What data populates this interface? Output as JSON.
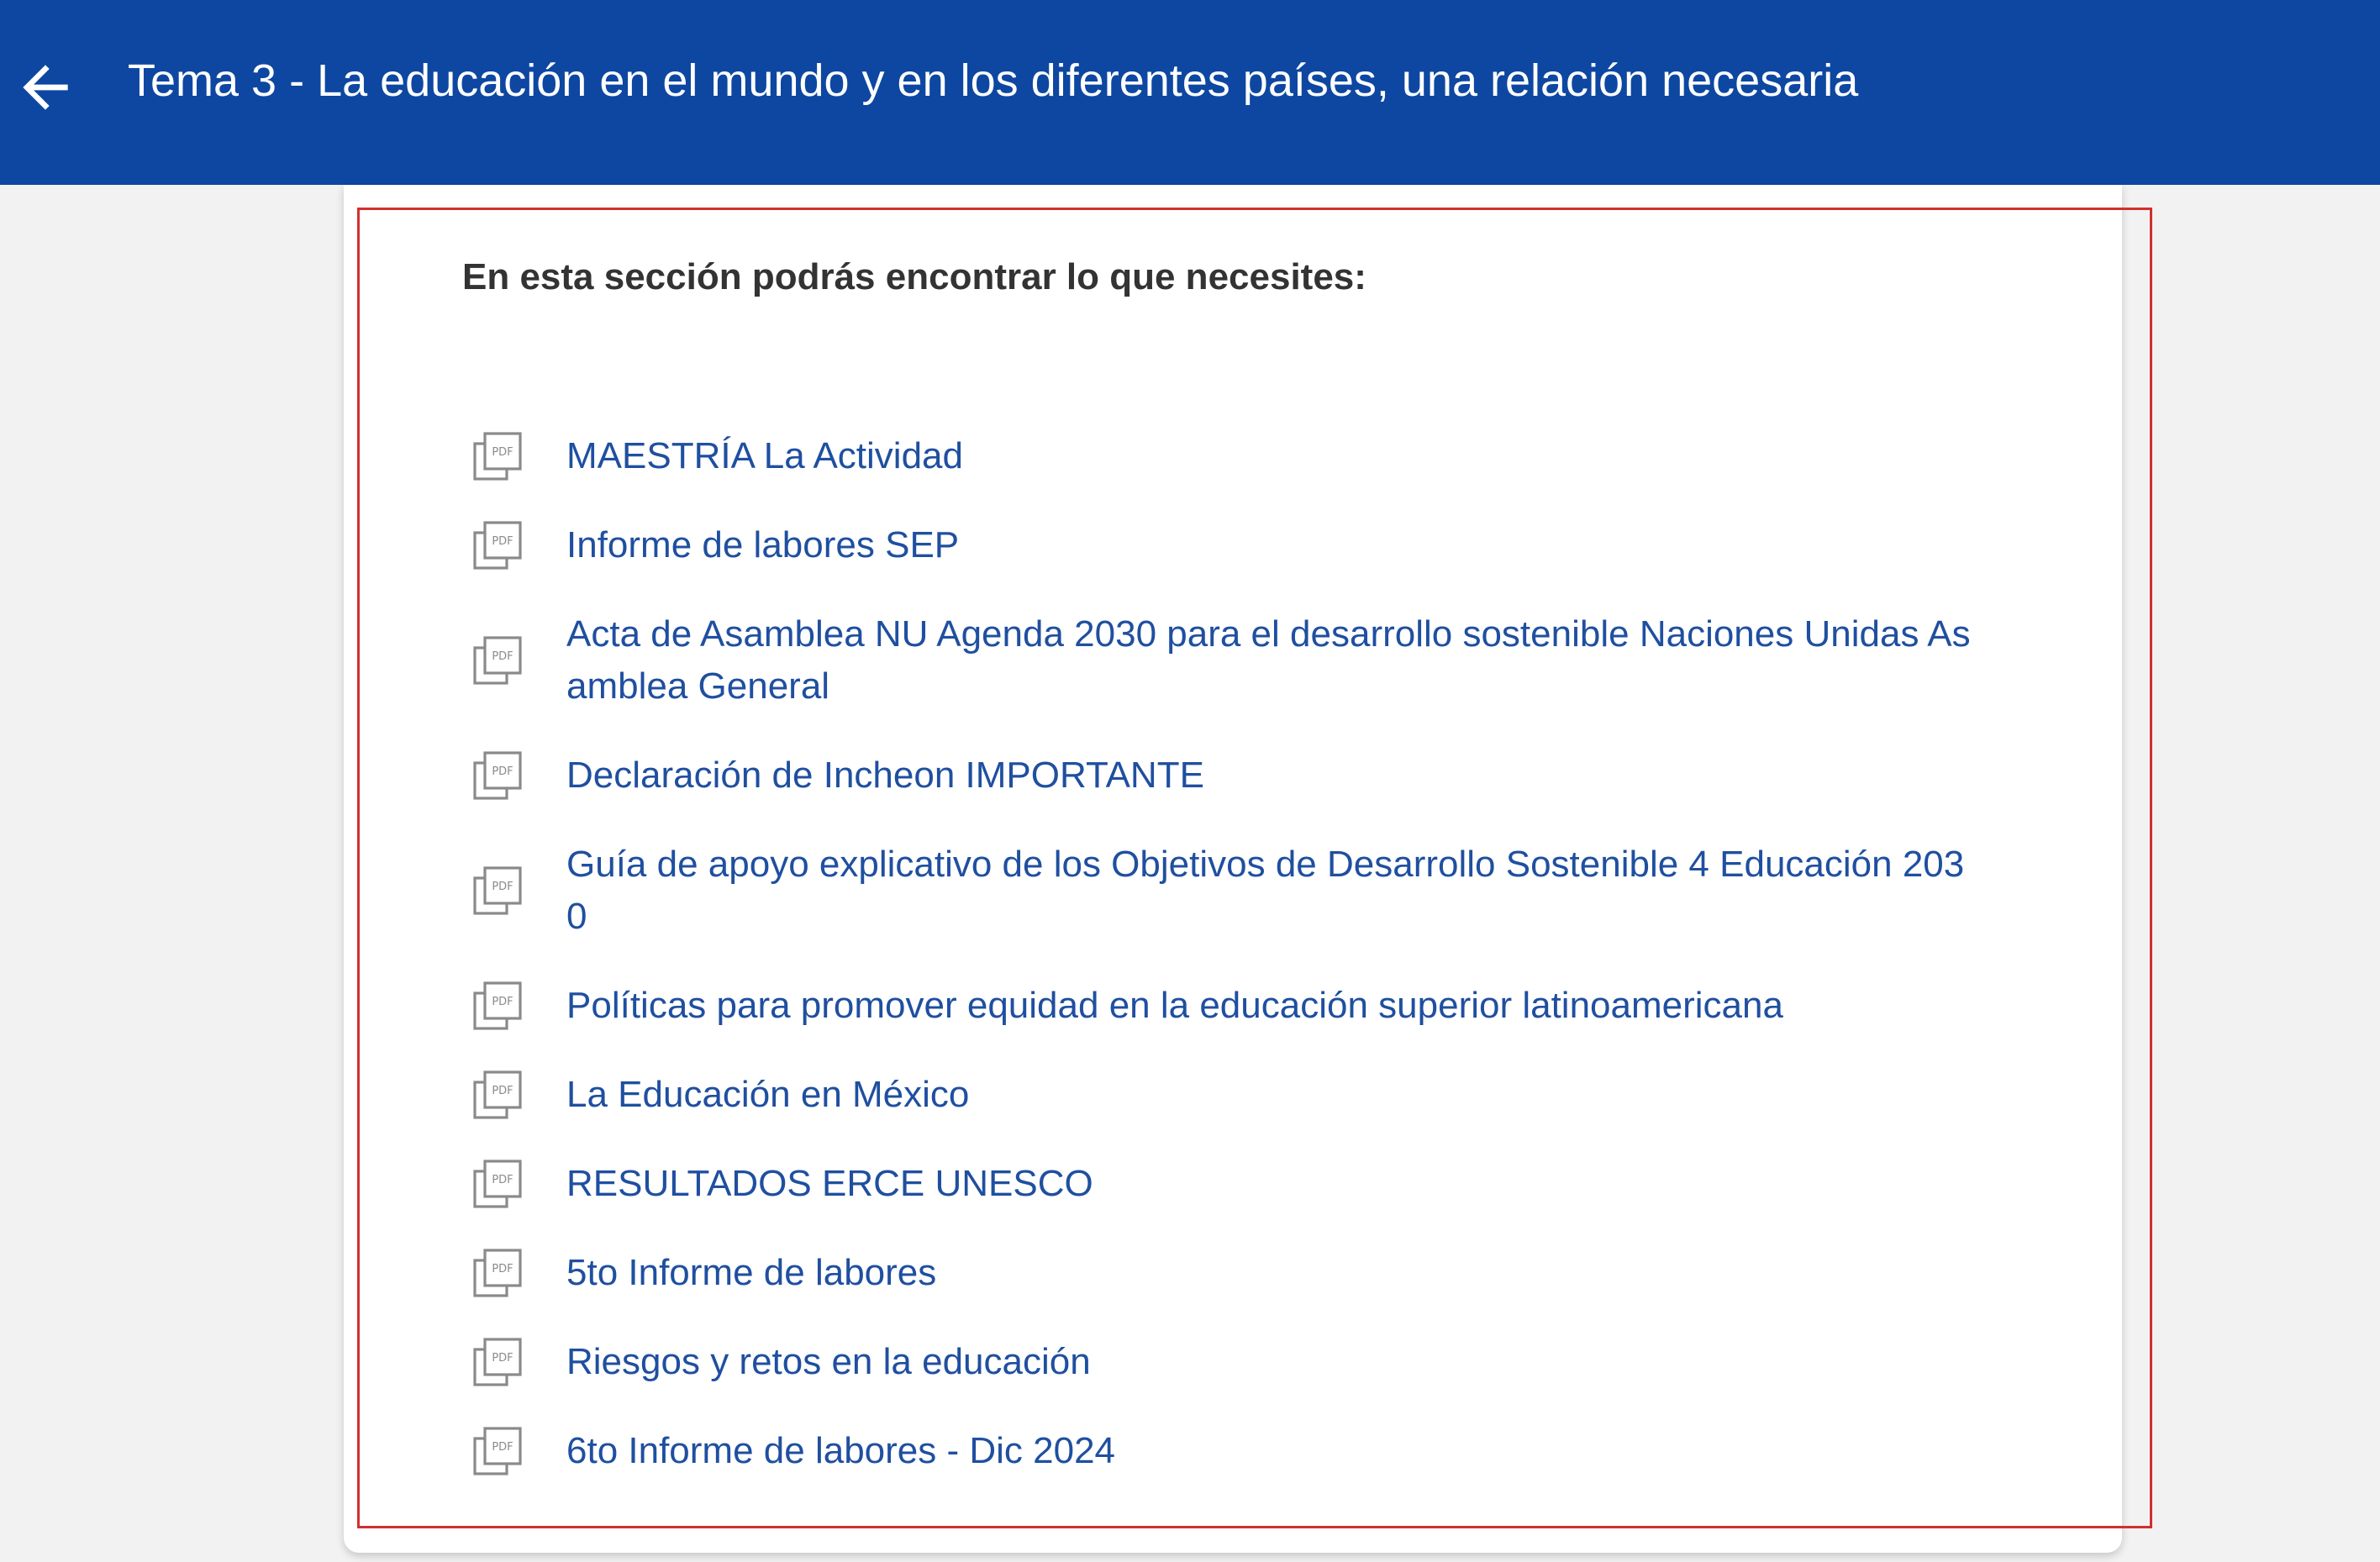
{
  "header": {
    "title": "Tema 3 - La educación en el mundo y en los diferentes países, una relación necesaria",
    "back_icon": "arrow-left-icon",
    "background_color": "#0d47a1"
  },
  "content": {
    "intro": "En esta sección podrás encontrar lo que necesites:",
    "link_color": "#1f4fa0",
    "item_icon": "pdf-file-icon",
    "documents": [
      {
        "label": "MAESTRÍA La Actividad"
      },
      {
        "label": "Informe de labores SEP"
      },
      {
        "label": "Acta de Asamblea NU Agenda 2030 para el desarrollo sostenible Naciones Unidas Asamblea General"
      },
      {
        "label": "Declaración de Incheon IMPORTANTE"
      },
      {
        "label": "Guía de apoyo explicativo de los Objetivos de Desarrollo Sostenible 4 Educación 2030"
      },
      {
        "label": "Políticas para promover equidad en la educación superior latinoamericana"
      },
      {
        "label": "La Educación en México"
      },
      {
        "label": "RESULTADOS ERCE UNESCO"
      },
      {
        "label": "5to Informe de labores"
      },
      {
        "label": "Riesgos y retos en la educación"
      },
      {
        "label": "6to Informe de labores - Dic 2024"
      }
    ]
  }
}
